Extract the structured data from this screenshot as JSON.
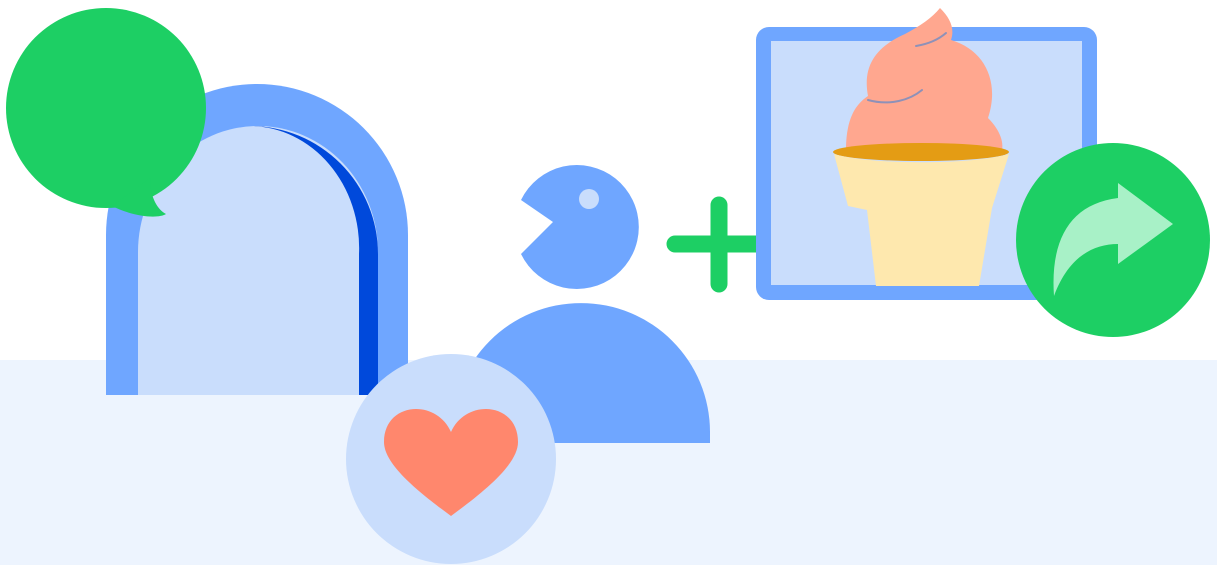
{
  "colors": {
    "background": "#ffffff",
    "floor": "#edf4fe",
    "blue_primary": "#6fa6ff",
    "blue_light": "#c9ddfc",
    "blue_dark": "#0049db",
    "green": "#1dcf64",
    "green_light": "#a8f1c7",
    "coral": "#ff876d",
    "ice_cream": "#ffa78f",
    "ice_cream_swirl": "#8e91b8",
    "cone": "#fee8ae",
    "cone_rim": "#e49c14"
  },
  "icons": [
    "chat-bubble-icon",
    "doorway-icon",
    "person-icon",
    "plus-icon",
    "heart-icon",
    "ice-cream-picture-icon",
    "share-arrow-icon"
  ]
}
